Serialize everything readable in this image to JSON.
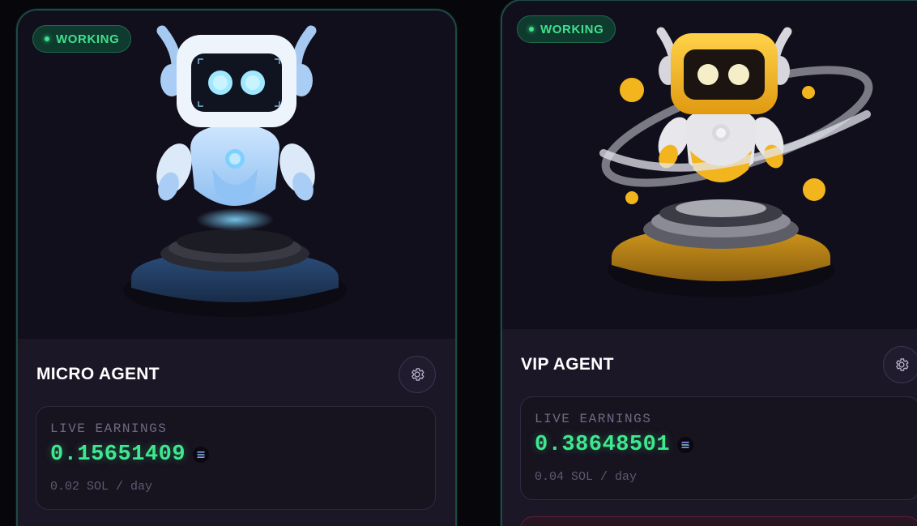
{
  "cards": [
    {
      "status": "WORKING",
      "title": "MICRO AGENT",
      "earnings_label": "LIVE EARNINGS",
      "earnings_value": "0.15651409",
      "rate": "0.02 SOL / day",
      "robot_theme": "blue-white",
      "settings_icon": "gear-icon",
      "currency_icon": "solana-icon"
    },
    {
      "status": "WORKING",
      "title": "VIP AGENT",
      "earnings_label": "LIVE EARNINGS",
      "earnings_value": "0.38648501",
      "rate": "0.04 SOL / day",
      "robot_theme": "gold-white",
      "settings_icon": "gear-icon",
      "currency_icon": "solana-icon"
    }
  ],
  "colors": {
    "accent_green": "#3ee88e",
    "card_border": "#1d4a43",
    "card_bg": "#1b1727",
    "art_bg": "#120f1c",
    "blue_robot": "#8fc3f5",
    "gold_robot": "#f2b51e"
  }
}
